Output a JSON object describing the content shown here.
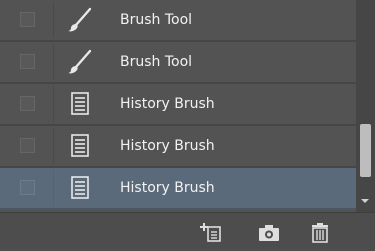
{
  "history": {
    "items": [
      {
        "label": "Brush Tool",
        "icon": "brush-icon",
        "selected": false
      },
      {
        "label": "Brush Tool",
        "icon": "brush-icon",
        "selected": false
      },
      {
        "label": "History Brush",
        "icon": "document-icon",
        "selected": false
      },
      {
        "label": "History Brush",
        "icon": "document-icon",
        "selected": false
      },
      {
        "label": "History Brush",
        "icon": "document-icon",
        "selected": true
      }
    ]
  },
  "footer": {
    "buttons": [
      {
        "name": "new-document-from-state-button",
        "icon": "new-document-icon"
      },
      {
        "name": "create-snapshot-button",
        "icon": "camera-icon"
      },
      {
        "name": "delete-state-button",
        "icon": "trash-icon"
      }
    ]
  },
  "colors": {
    "panel_bg": "#535353",
    "selected_bg": "#5a6a7a",
    "text": "#f2f2f2"
  }
}
